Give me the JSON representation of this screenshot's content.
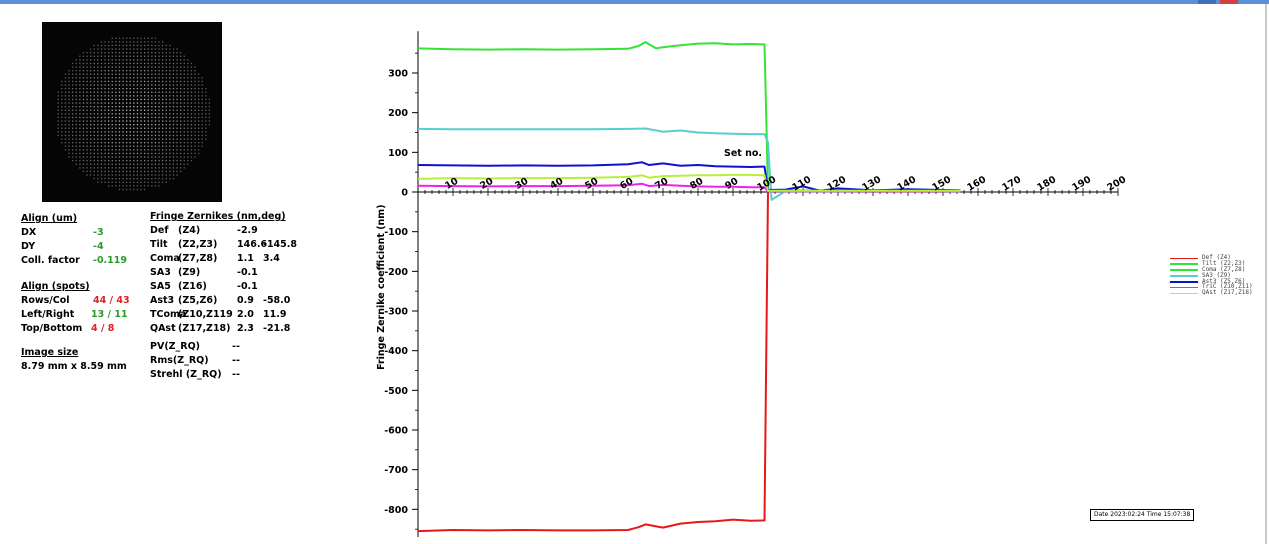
{
  "align_um": {
    "header": "Align (um)",
    "rows": [
      {
        "label": "DX",
        "value": "-3"
      },
      {
        "label": "DY",
        "value": "-4"
      },
      {
        "label": "Coll. factor",
        "value": "-0.119"
      }
    ]
  },
  "align_spots": {
    "header": "Align (spots)",
    "rows": [
      {
        "label": "Rows/Col",
        "a": "44",
        "sep": "/",
        "b": "43",
        "color": "#e02020"
      },
      {
        "label": "Left/Right",
        "a": "13",
        "sep": "/",
        "b": "11",
        "color": "#2a9a2a"
      },
      {
        "label": "Top/Bottom",
        "a": "4",
        "sep": "/",
        "b": "8",
        "color": "#e02020"
      }
    ]
  },
  "image_size": {
    "header": "Image size",
    "value": "8.79 mm x 8.59 mm"
  },
  "zernikes": {
    "header": "Fringe Zernikes (nm,deg)",
    "rows": [
      {
        "name": "Def",
        "terms": "(Z4)",
        "v1": "-2.9",
        "v2": ""
      },
      {
        "name": "Tilt",
        "terms": "(Z2,Z3)",
        "v1": "146.6",
        "v2": "-145.8"
      },
      {
        "name": "Coma",
        "terms": "(Z7,Z8)",
        "v1": "1.1",
        "v2": "3.4"
      },
      {
        "name": "SA3",
        "terms": "(Z9)",
        "v1": "-0.1",
        "v2": ""
      },
      {
        "name": "SA5",
        "terms": "(Z16)",
        "v1": "-0.1",
        "v2": ""
      },
      {
        "name": "Ast3",
        "terms": "(Z5,Z6)",
        "v1": "0.9",
        "v2": "-58.0"
      },
      {
        "name": "TComa",
        "terms": "(Z10,Z119",
        "v1": "2.0",
        "v2": "11.9"
      },
      {
        "name": "QAst",
        "terms": "(Z17,Z18)",
        "v1": "2.3",
        "v2": "-21.8"
      }
    ]
  },
  "quality": [
    {
      "label": "PV(Z_RQ)",
      "value": "--"
    },
    {
      "label": "Rms(Z_RQ)",
      "value": "--"
    },
    {
      "label": "Strehl (Z_RQ)",
      "value": "--"
    }
  ],
  "legend": [
    {
      "label": "Def (Z4)",
      "color": "#e81818"
    },
    {
      "label": "Tilt (Z2,Z3)",
      "color": "#36e236"
    },
    {
      "label": "Coma (Z7,Z8)",
      "color": "#36e236"
    },
    {
      "label": "SA3 (Z9)",
      "color": "#56cfcf"
    },
    {
      "label": "Ast3 (Z5,Z6)",
      "color": "#1010d0"
    },
    {
      "label": "TriC (Z10,Z11)",
      "color": "#ee22ee"
    },
    {
      "label": "QAst (Z17,Z18)",
      "color": "#b8ee3c"
    }
  ],
  "datebox": "Date 2023:02:24 Time 15:07:38",
  "chart_data": {
    "type": "line",
    "title": "",
    "xlabel": "Set no.",
    "ylabel": "Fringe Zernike coefficient (nm)",
    "xlim": [
      0,
      200
    ],
    "ylim": [
      -870,
      390
    ],
    "xticks": [
      10,
      20,
      30,
      40,
      50,
      60,
      70,
      80,
      90,
      100,
      110,
      120,
      130,
      140,
      150,
      160,
      170,
      180,
      190,
      200
    ],
    "yticks": [
      300,
      200,
      100,
      0,
      -100,
      -200,
      -300,
      -400,
      -500,
      -600,
      -700,
      -800
    ],
    "series": [
      {
        "name": "Def (Z4)",
        "color": "#e81818",
        "x": [
          0,
          10,
          20,
          30,
          40,
          50,
          60,
          63,
          65,
          70,
          75,
          80,
          85,
          90,
          95,
          99,
          100,
          105,
          120,
          140,
          155
        ],
        "y": [
          -855,
          -852,
          -853,
          -852,
          -853,
          -853,
          -852,
          -845,
          -838,
          -846,
          -836,
          -832,
          -830,
          -826,
          -829,
          -828,
          2,
          3,
          3,
          2,
          3
        ]
      },
      {
        "name": "Tilt (Z2,Z3)",
        "color": "#36e236",
        "x": [
          0,
          10,
          20,
          30,
          40,
          50,
          60,
          63,
          65,
          68,
          70,
          75,
          80,
          85,
          90,
          95,
          99,
          100,
          105,
          120,
          140,
          155
        ],
        "y": [
          362,
          360,
          359,
          360,
          359,
          360,
          361,
          368,
          378,
          362,
          365,
          370,
          374,
          375,
          372,
          373,
          372,
          5,
          4,
          4,
          4,
          4
        ]
      },
      {
        "name": "SA3 (Z9)",
        "color": "#56cfcf",
        "x": [
          0,
          10,
          20,
          30,
          40,
          50,
          60,
          65,
          70,
          75,
          80,
          85,
          90,
          95,
          99,
          100,
          101,
          105,
          120,
          140,
          155
        ],
        "y": [
          159,
          158,
          158,
          158,
          158,
          158,
          159,
          160,
          152,
          155,
          150,
          148,
          147,
          146,
          146,
          125,
          -20,
          2,
          2,
          3,
          2
        ]
      },
      {
        "name": "Ast3 (Z5,Z6)",
        "color": "#1010d0",
        "x": [
          0,
          10,
          20,
          30,
          40,
          50,
          60,
          64,
          66,
          70,
          75,
          80,
          85,
          90,
          95,
          99,
          100,
          105,
          110,
          115,
          120,
          130,
          140,
          155
        ],
        "y": [
          68,
          67,
          66,
          67,
          66,
          67,
          70,
          75,
          68,
          72,
          66,
          68,
          65,
          64,
          63,
          64,
          5,
          6,
          14,
          3,
          9,
          4,
          7,
          4
        ]
      },
      {
        "name": "TriC (Z10,Z11)",
        "color": "#ee22ee",
        "x": [
          0,
          10,
          20,
          30,
          40,
          50,
          60,
          64,
          66,
          70,
          75,
          80,
          85,
          90,
          95,
          99,
          100,
          105,
          120,
          140,
          155
        ],
        "y": [
          16,
          15,
          14,
          15,
          15,
          16,
          17,
          21,
          15,
          18,
          16,
          14,
          13,
          13,
          12,
          12,
          2,
          2,
          2,
          2,
          2
        ]
      },
      {
        "name": "QAst (Z17,Z18)",
        "color": "#b8ee3c",
        "x": [
          0,
          10,
          20,
          30,
          40,
          50,
          60,
          64,
          66,
          70,
          75,
          80,
          85,
          90,
          95,
          99,
          100,
          105,
          120,
          140,
          155
        ],
        "y": [
          33,
          35,
          34,
          35,
          35,
          36,
          38,
          42,
          36,
          40,
          41,
          42,
          42,
          43,
          43,
          42,
          3,
          3,
          3,
          3,
          3
        ]
      }
    ]
  }
}
